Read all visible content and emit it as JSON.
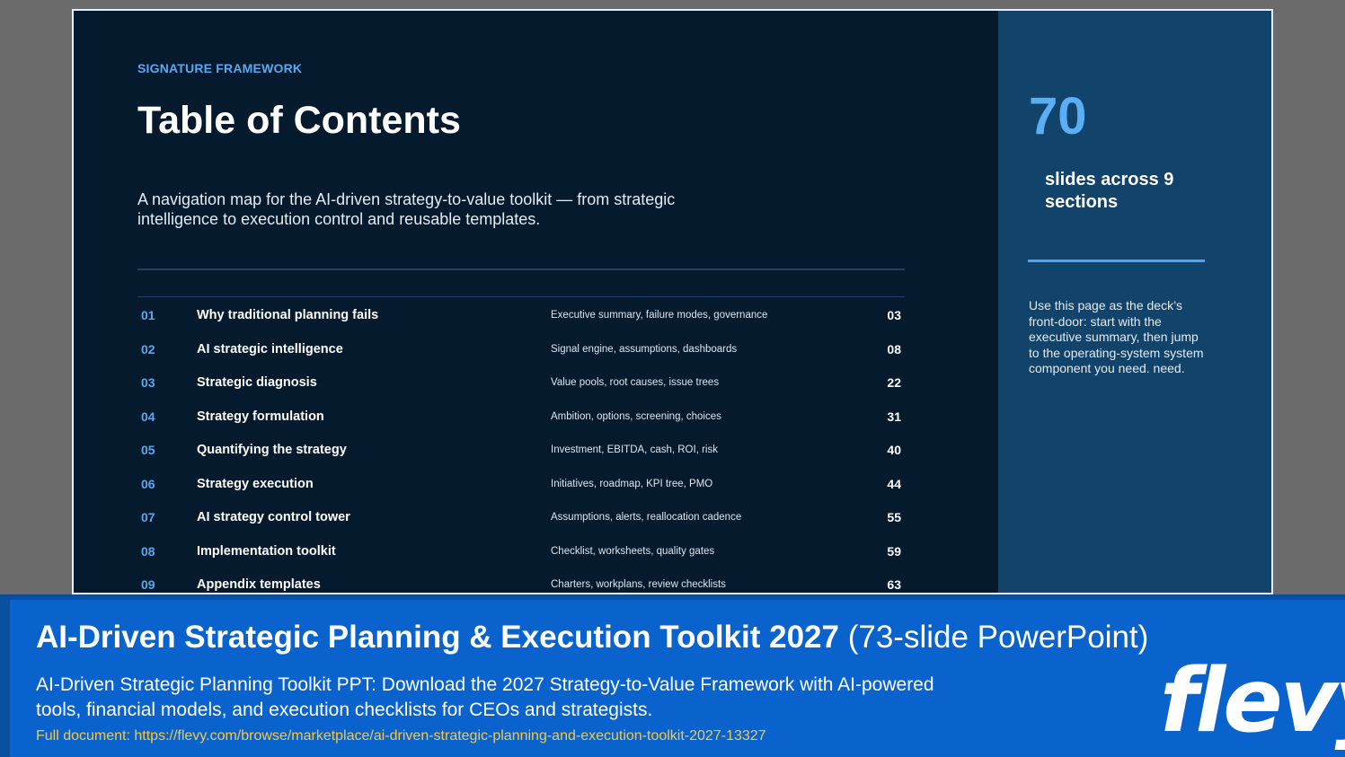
{
  "slide": {
    "eyebrow": "SIGNATURE FRAMEWORK",
    "title": "Table of Contents",
    "intro": "A navigation map for the AI-driven strategy-to-value toolkit — from strategic intelligence to execution control and reusable templates.",
    "toc": [
      {
        "num": "01",
        "name": "Why traditional planning fails",
        "desc": "Executive summary, failure modes, governance",
        "page": "03"
      },
      {
        "num": "02",
        "name": "AI strategic intelligence",
        "desc": "Signal engine, assumptions, dashboards",
        "page": "08"
      },
      {
        "num": "03",
        "name": "Strategic diagnosis",
        "desc": "Value pools, root causes, issue trees",
        "page": "22"
      },
      {
        "num": "04",
        "name": "Strategy formulation",
        "desc": "Ambition, options, screening, choices",
        "page": "31"
      },
      {
        "num": "05",
        "name": "Quantifying the strategy",
        "desc": "Investment, EBITDA, cash, ROI, risk",
        "page": "40"
      },
      {
        "num": "06",
        "name": "Strategy execution",
        "desc": "Initiatives, roadmap, KPI tree, PMO",
        "page": "44"
      },
      {
        "num": "07",
        "name": "AI strategy control tower",
        "desc": "Assumptions, alerts, reallocation cadence",
        "page": "55"
      },
      {
        "num": "08",
        "name": "Implementation toolkit",
        "desc": "Checklist, worksheets, quality gates",
        "page": "59"
      },
      {
        "num": "09",
        "name": "Appendix templates",
        "desc": "Charters, workplans, review checklists",
        "page": "63"
      }
    ],
    "sidebar": {
      "count": "70",
      "count_label": "slides across 9 sections",
      "note": "Use this page as the deck’s front-door: start with the executive summary, then jump to the operating-system system component you need. need."
    }
  },
  "banner": {
    "title_bold": "AI-Driven Strategic Planning & Execution Toolkit 2027",
    "title_light": " (73-slide PowerPoint)",
    "description": "AI-Driven Strategic Planning Toolkit PPT: Download the 2027 Strategy-to-Value Framework with AI-powered tools, financial models, and execution checklists for CEOs and strategists.",
    "link": "Full document: https://flevy.com/browse/marketplace/ai-driven-strategic-planning-and-execution-toolkit-2027-13327",
    "logo": "flevy"
  }
}
